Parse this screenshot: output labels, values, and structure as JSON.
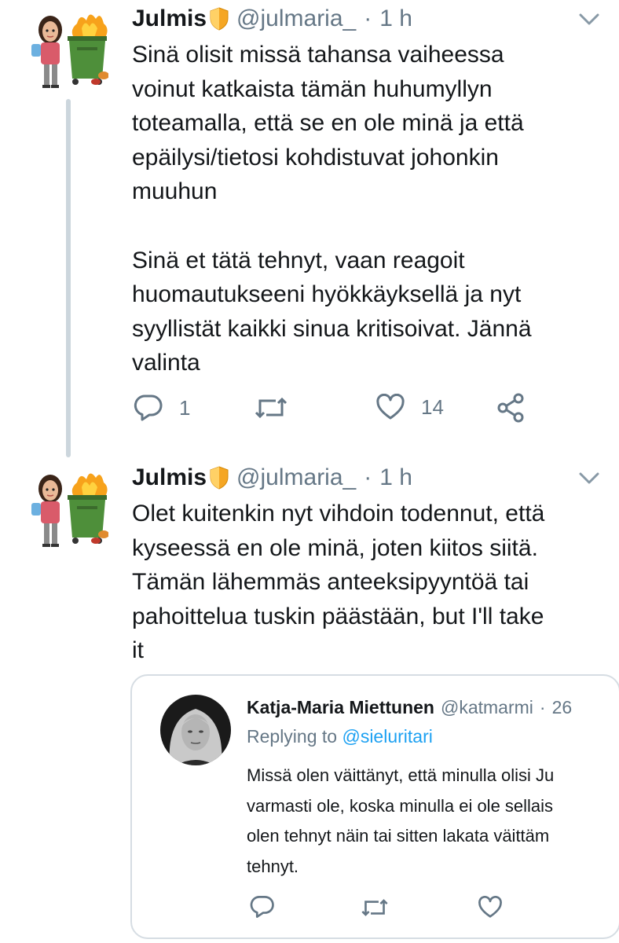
{
  "tweets": [
    {
      "name": "Julmis",
      "handle": "@julmaria_",
      "separator": "·",
      "time": "1 h",
      "text": "Sinä olisit missä tahansa vaiheessa\nvoinut katkaista tämän huhumyllyn\ntoteamalla, että se en ole minä ja että\nepäilysi/tietosi kohdistuvat johonkin\nmuuhun\n\nSinä et tätä tehnyt, vaan reagoit\nhuomautukseeni hyökkäyksellä ja nyt\nsyyllistät kaikki sinua kritisoivat. Jännä\nvalinta",
      "reply_count": "1",
      "like_count": "14"
    },
    {
      "name": "Julmis",
      "handle": "@julmaria_",
      "separator": "·",
      "time": "1 h",
      "text": "Olet kuitenkin nyt vihdoin todennut, että\nkyseessä en ole minä, joten kiitos siitä.\nTämän lähemmäs anteeksipyyntöä tai\npahoittelua tuskin päästään, but I'll take\nit"
    }
  ],
  "quoted_tweet": {
    "name": "Katja-Maria Miettunen",
    "handle": "@katmarmi",
    "separator": "·",
    "time": "26",
    "replying_to_label": "Replying to",
    "replying_to_handle": "@sieluritari",
    "text_lines": [
      "Missä olen väittänyt, että minulla olisi Ju",
      "varmasti ole, koska minulla ei ole sellais",
      "olen tehnyt näin tai sitten lakata väittäm",
      "tehnyt."
    ]
  },
  "colors": {
    "text": "#14171a",
    "secondary": "#657786",
    "accent": "#1da1f2",
    "thread_line": "#ccd6dd",
    "badge": "#f5a623"
  },
  "icons": [
    "reply-icon",
    "retweet-icon",
    "like-icon",
    "share-icon",
    "chevron-down-icon",
    "shield-badge-icon"
  ]
}
